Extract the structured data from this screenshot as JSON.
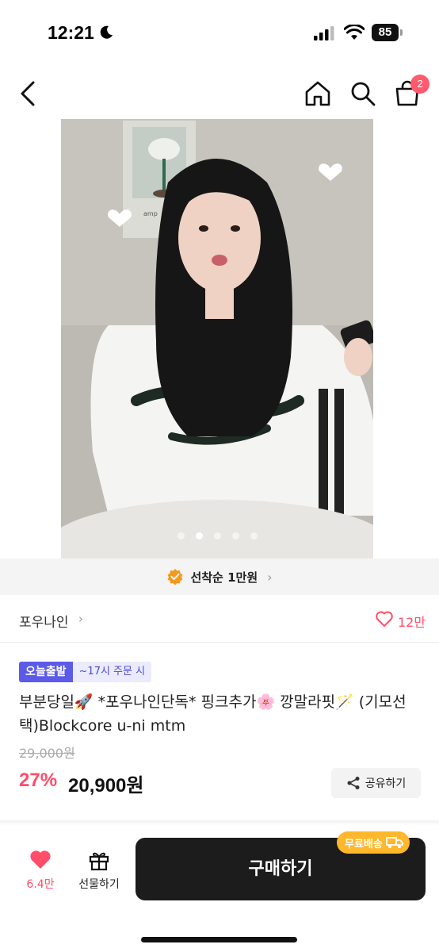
{
  "status_bar": {
    "time": "12:21",
    "battery": "85"
  },
  "nav": {
    "cart_count": "2"
  },
  "product_image": {
    "dots": 5,
    "active_dot": 1
  },
  "promo": {
    "text": "선착순 1만원",
    "chevron": "›"
  },
  "store": {
    "name": "포우나인",
    "chevron": "›",
    "likes": "12만"
  },
  "tags": {
    "today": "오늘출발",
    "time": "~17시 주문 시"
  },
  "product": {
    "title": "부분당일🚀 *포우나인단독* 핑크추가🌸 깡말라핏🪄 (기모선택)Blockcore u-ni mtm",
    "original_price": "29,000원",
    "discount": "27%",
    "price": "20,900원"
  },
  "share": {
    "label": "공유하기"
  },
  "bottom": {
    "wish_count": "6.4만",
    "gift_label": "선물하기",
    "buy_label": "구매하기",
    "free_ship": "무료배송"
  },
  "colors": {
    "accent_pink": "#ff4d6a",
    "tag_purple": "#5b5be8",
    "free_ship_orange": "#ffb72b",
    "buy_button": "#1c1c1c"
  }
}
